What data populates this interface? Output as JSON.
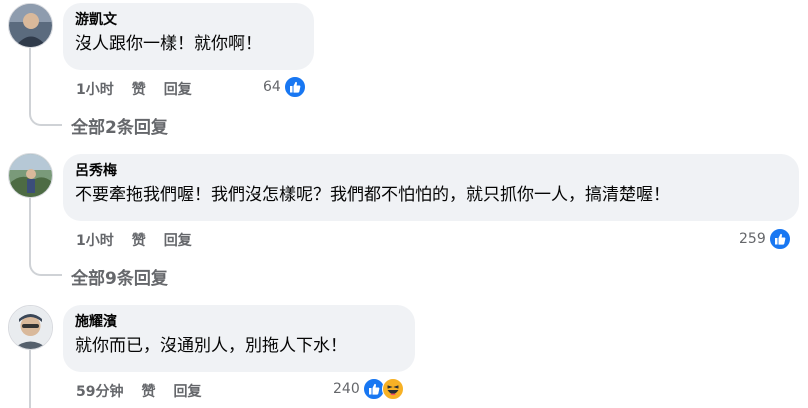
{
  "comments": [
    {
      "author": "游凱文",
      "text": "沒人跟你一樣！就你啊！",
      "time": "1小时",
      "like_label": "赞",
      "reply_label": "回复",
      "reaction_count": "64",
      "reactions": [
        "like-icon"
      ],
      "view_replies": "全部2条回复"
    },
    {
      "author": "呂秀梅",
      "text": "不要牽拖我們喔！我們沒怎樣呢？我們都不怕怕的，就只抓你一人，搞清楚喔！",
      "time": "1小时",
      "like_label": "赞",
      "reply_label": "回复",
      "reaction_count": "259",
      "reactions": [
        "like-icon"
      ],
      "view_replies": "全部9条回复"
    },
    {
      "author": "施耀濱",
      "text": "就你而已，沒通別人，別拖人下水！",
      "time": "59分钟",
      "like_label": "赞",
      "reply_label": "回复",
      "reaction_count": "240",
      "reactions": [
        "like-icon",
        "haha-icon"
      ]
    }
  ],
  "colors": {
    "like_blue": "#1877f2",
    "haha_yellow": "#f7b125",
    "bubble_bg": "#f0f2f5",
    "secondary_text": "#65676b"
  }
}
